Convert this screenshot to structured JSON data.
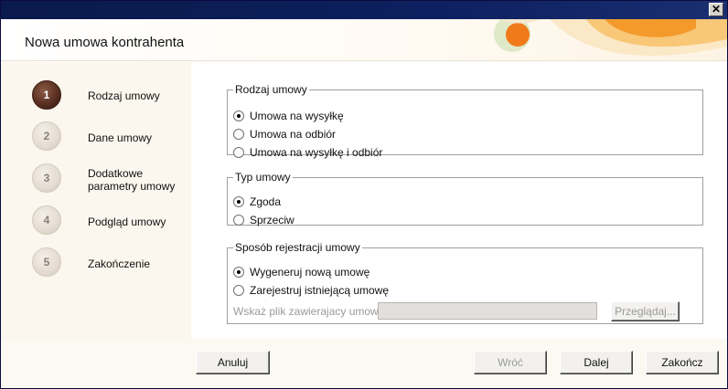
{
  "window": {
    "title": "Nowa umowa kontrahenta",
    "close_symbol": "✕"
  },
  "steps": [
    {
      "number": "1",
      "label": "Rodzaj umowy",
      "active": true
    },
    {
      "number": "2",
      "label": "Dane umowy",
      "active": false
    },
    {
      "number": "3",
      "label": "Dodatkowe parametry umowy",
      "active": false
    },
    {
      "number": "4",
      "label": "Podgląd umowy",
      "active": false
    },
    {
      "number": "5",
      "label": "Zakończenie",
      "active": false
    }
  ],
  "contract_kind": {
    "legend": "Rodzaj umowy",
    "options": [
      "Umowa na wysyłkę",
      "Umowa na odbiór",
      "Umowa na wysyłkę i odbiór"
    ],
    "selected": "Umowa na wysyłkę"
  },
  "contract_type": {
    "legend": "Typ umowy",
    "options": [
      "Zgoda",
      "Sprzeciw"
    ],
    "selected": "Zgoda"
  },
  "registration": {
    "legend": "Sposób rejestracji umowy",
    "options": [
      "Wygeneruj nową umowę",
      "Zarejestruj istniejącą umowę"
    ],
    "selected": "Wygeneruj nową umowę",
    "file_label": "Wskaż plik zawierajacy umowę:",
    "file_value": "",
    "browse_label": "Przeglądaj..."
  },
  "buttons": {
    "cancel": "Anuluj",
    "back": "Wróć",
    "next": "Dalej",
    "finish": "Zakończ"
  },
  "colors": {
    "titlebar": "#0d2060",
    "active_step": "#5a2f22",
    "deco_orange": "#f08a1c",
    "deco_green": "#c8dca8"
  }
}
